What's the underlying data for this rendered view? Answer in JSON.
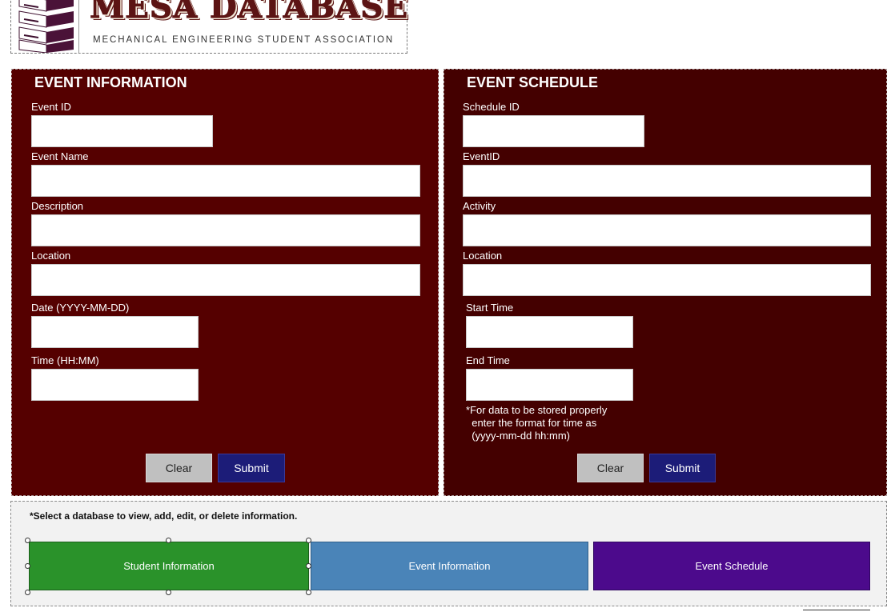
{
  "header": {
    "title": "MESA DATABASE",
    "subtitle": "MECHANICAL ENGINEERING STUDENT ASSOCIATION",
    "logo_icon": "server-stack-icon"
  },
  "event_information": {
    "title": "EVENT INFORMATION",
    "fields": [
      {
        "label": "Event ID",
        "value": ""
      },
      {
        "label": "Event Name",
        "value": ""
      },
      {
        "label": "Description",
        "value": ""
      },
      {
        "label": "Location",
        "value": ""
      },
      {
        "label": "Date (YYYY-MM-DD)",
        "value": ""
      },
      {
        "label": "Time (HH:MM)",
        "value": ""
      }
    ],
    "clear_label": "Clear",
    "submit_label": "Submit"
  },
  "event_schedule": {
    "title": "EVENT SCHEDULE",
    "fields": [
      {
        "label": "Schedule ID",
        "value": ""
      },
      {
        "label": "EventID",
        "value": ""
      },
      {
        "label": "Activity",
        "value": ""
      },
      {
        "label": "Location",
        "value": ""
      },
      {
        "label": "Start Time",
        "value": ""
      },
      {
        "label": "End Time",
        "value": ""
      }
    ],
    "note": "*For data to be stored properly\n  enter the format for time as\n  (yyyy-mm-dd hh:mm)",
    "clear_label": "Clear",
    "submit_label": "Submit"
  },
  "nav": {
    "instruction": "*Select a database to view, add, edit, or delete information.",
    "buttons": [
      {
        "label": "Student Information",
        "color": "#2a922a"
      },
      {
        "label": "Event Information",
        "color": "#4a84b8"
      },
      {
        "label": "Event Schedule",
        "color": "#4c0a8c"
      }
    ]
  },
  "colors": {
    "event_info_panel": "#550000",
    "event_schedule_panel": "#440000",
    "submit_button": "#1c1c78",
    "clear_button": "#c0c0c0"
  }
}
